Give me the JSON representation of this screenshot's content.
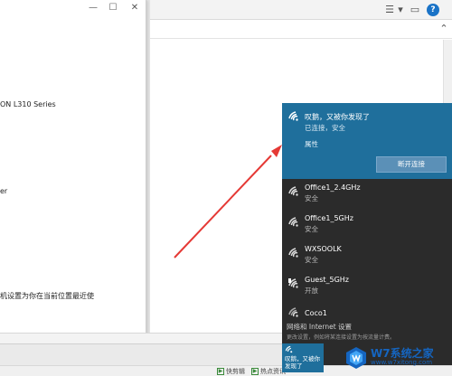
{
  "settings_window": {
    "printer_label": "ON L310 Series",
    "fragment_er": "er",
    "location_text": "机设置为你在当前位置最近使"
  },
  "wifi_flyout": {
    "connected": {
      "name": "叹鹅，又被你发现了",
      "status": "已连接，安全",
      "properties_label": "属性",
      "disconnect_label": "断开连接"
    },
    "networks": [
      {
        "name": "Office1_2.4GHz",
        "status": "安全"
      },
      {
        "name": "Office1_5GHz",
        "status": "安全"
      },
      {
        "name": "WXSOOLK",
        "status": "安全"
      },
      {
        "name": "Guest_5GHz",
        "status": "开放"
      },
      {
        "name": "Coco1",
        "status": ""
      }
    ],
    "settings_link": "网络和 Internet 设置",
    "settings_sub": "更改设置，例如将某连接设置为按流量计费。"
  },
  "wifi_tile": {
    "label": "叹鹅，又被你发现了"
  },
  "status_bar": {
    "item1": "快剪辑",
    "item2": "热点资讯"
  },
  "watermark": {
    "title": "W7系统之家",
    "url": "www.w7xitong.com"
  },
  "colors": {
    "accent": "#1f6f9c",
    "flyout_bg": "#2b2b2b",
    "arrow": "#e53935"
  }
}
